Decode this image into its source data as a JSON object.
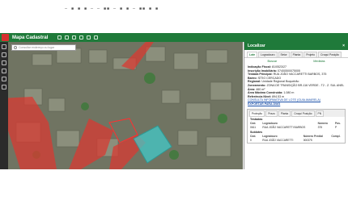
{
  "browser": {
    "tab_text": "— ■ ■ ■ — — ■■ — ■ ■ — ■■ ■ ■"
  },
  "app": {
    "title": "Mapa Cadastral"
  },
  "search": {
    "placeholder": "Consultar endereço ou lugar"
  },
  "panel": {
    "title": "Localizar",
    "close": "×",
    "tabs": [
      "Lote",
      "Logradouro",
      "Setor",
      "Planta",
      "Projeto",
      "Croqui Posição"
    ],
    "subtabs": [
      "Buscar",
      "Medidas"
    ],
    "info": [
      {
        "label": "Indicação Fiscal:",
        "value": "81/0523/27"
      },
      {
        "label": "Inscrição Imobiliária:",
        "value": "07400500075005"
      },
      {
        "label": "Testada Principal:",
        "value": "RUA JOÃO VACCARETTI BARBOS, 375"
      },
      {
        "label": "Bairro:",
        "value": "SÍTIO CERCADO"
      },
      {
        "label": "Regional:",
        "value": "Unidade Regional Boqueirão"
      },
      {
        "label": "Zoneamento:",
        "value": "ZONA DE TRANSIÇÃO BR-116 VERDE - T2 - Z. SUL ANEL"
      },
      {
        "label": "Área:",
        "value": "460 m²"
      },
      {
        "label": "Área Máxima Construída:",
        "value": "1.080 m"
      },
      {
        "label": "Referência Nivel:",
        "value": "894.53 m"
      }
    ],
    "link": "CONSULTA INFORMATIVA DE LOTE (GUIA AMARELA)",
    "export": "EXPORTAR PARA DWG",
    "box_tabs": [
      "Proteção",
      "Prazo",
      "Planta",
      "Croqui Posição",
      "PN"
    ],
    "testadas": {
      "title": "Testadas",
      "headers": [
        "Cód.",
        "Logradouro",
        "Número",
        "Pos."
      ],
      "rows": [
        [
          "0611",
          "RUA JOÃO VACCARETTI BARBOS",
          "375",
          "P"
        ]
      ]
    },
    "sublotes": {
      "title": "Sublotes",
      "headers": [
        "Cód.",
        "Logradouro",
        "Número Predial",
        "Compl."
      ],
      "rows": [
        [
          "0",
          "RUA JOÃO VACCARETTI",
          "000375",
          ""
        ]
      ]
    }
  },
  "colors": {
    "appbar": "#1f7a3a",
    "highlight_lot": "#3fd0d0",
    "red_overlay": "#d93a32"
  }
}
